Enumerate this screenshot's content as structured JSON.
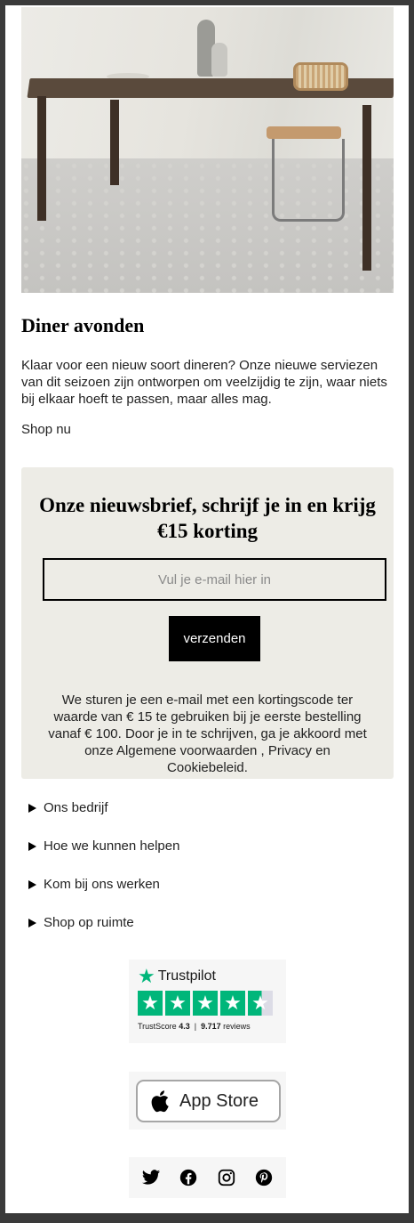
{
  "article": {
    "title": "Diner avonden",
    "body": "Klaar voor een nieuw soort dineren? Onze nieuwe serviezen van dit seizoen zijn ontworpen om veelzijdig te zijn, waar niets bij elkaar hoeft te passen, maar alles mag.",
    "link_label": "Shop nu"
  },
  "newsletter": {
    "title": "Onze nieuwsbrief, schrijf je in en krijg €15 korting",
    "email_placeholder": "Vul je e-mail hier in",
    "email_value": "",
    "submit_label": "verzenden",
    "disclaimer": "We sturen je een e-mail met een kortingscode ter waarde van € 15 te gebruiken bij je eerste bestelling vanaf € 100. Door je in te schrijven, ga je akkoord met onze Algemene voorwaarden , Privacy en Cookiebeleid."
  },
  "footer_sections": [
    {
      "label": "Ons bedrijf"
    },
    {
      "label": "Hoe we kunnen helpen"
    },
    {
      "label": "Kom bij ons werken"
    },
    {
      "label": "Shop op ruimte"
    }
  ],
  "trustpilot": {
    "brand": "Trustpilot",
    "trustscore_label": "TrustScore",
    "trustscore": "4.3",
    "reviews": "9.717",
    "reviews_label": "reviews",
    "rating_stars": 4.5
  },
  "app_store": {
    "label": "App Store",
    "icon": "apple-icon"
  },
  "social": [
    {
      "icon": "twitter-icon"
    },
    {
      "icon": "facebook-icon"
    },
    {
      "icon": "instagram-icon"
    },
    {
      "icon": "pinterest-icon"
    }
  ],
  "colors": {
    "newsletter_bg": "#edece6",
    "button_bg": "#000000",
    "trustpilot_green": "#00b67a"
  }
}
